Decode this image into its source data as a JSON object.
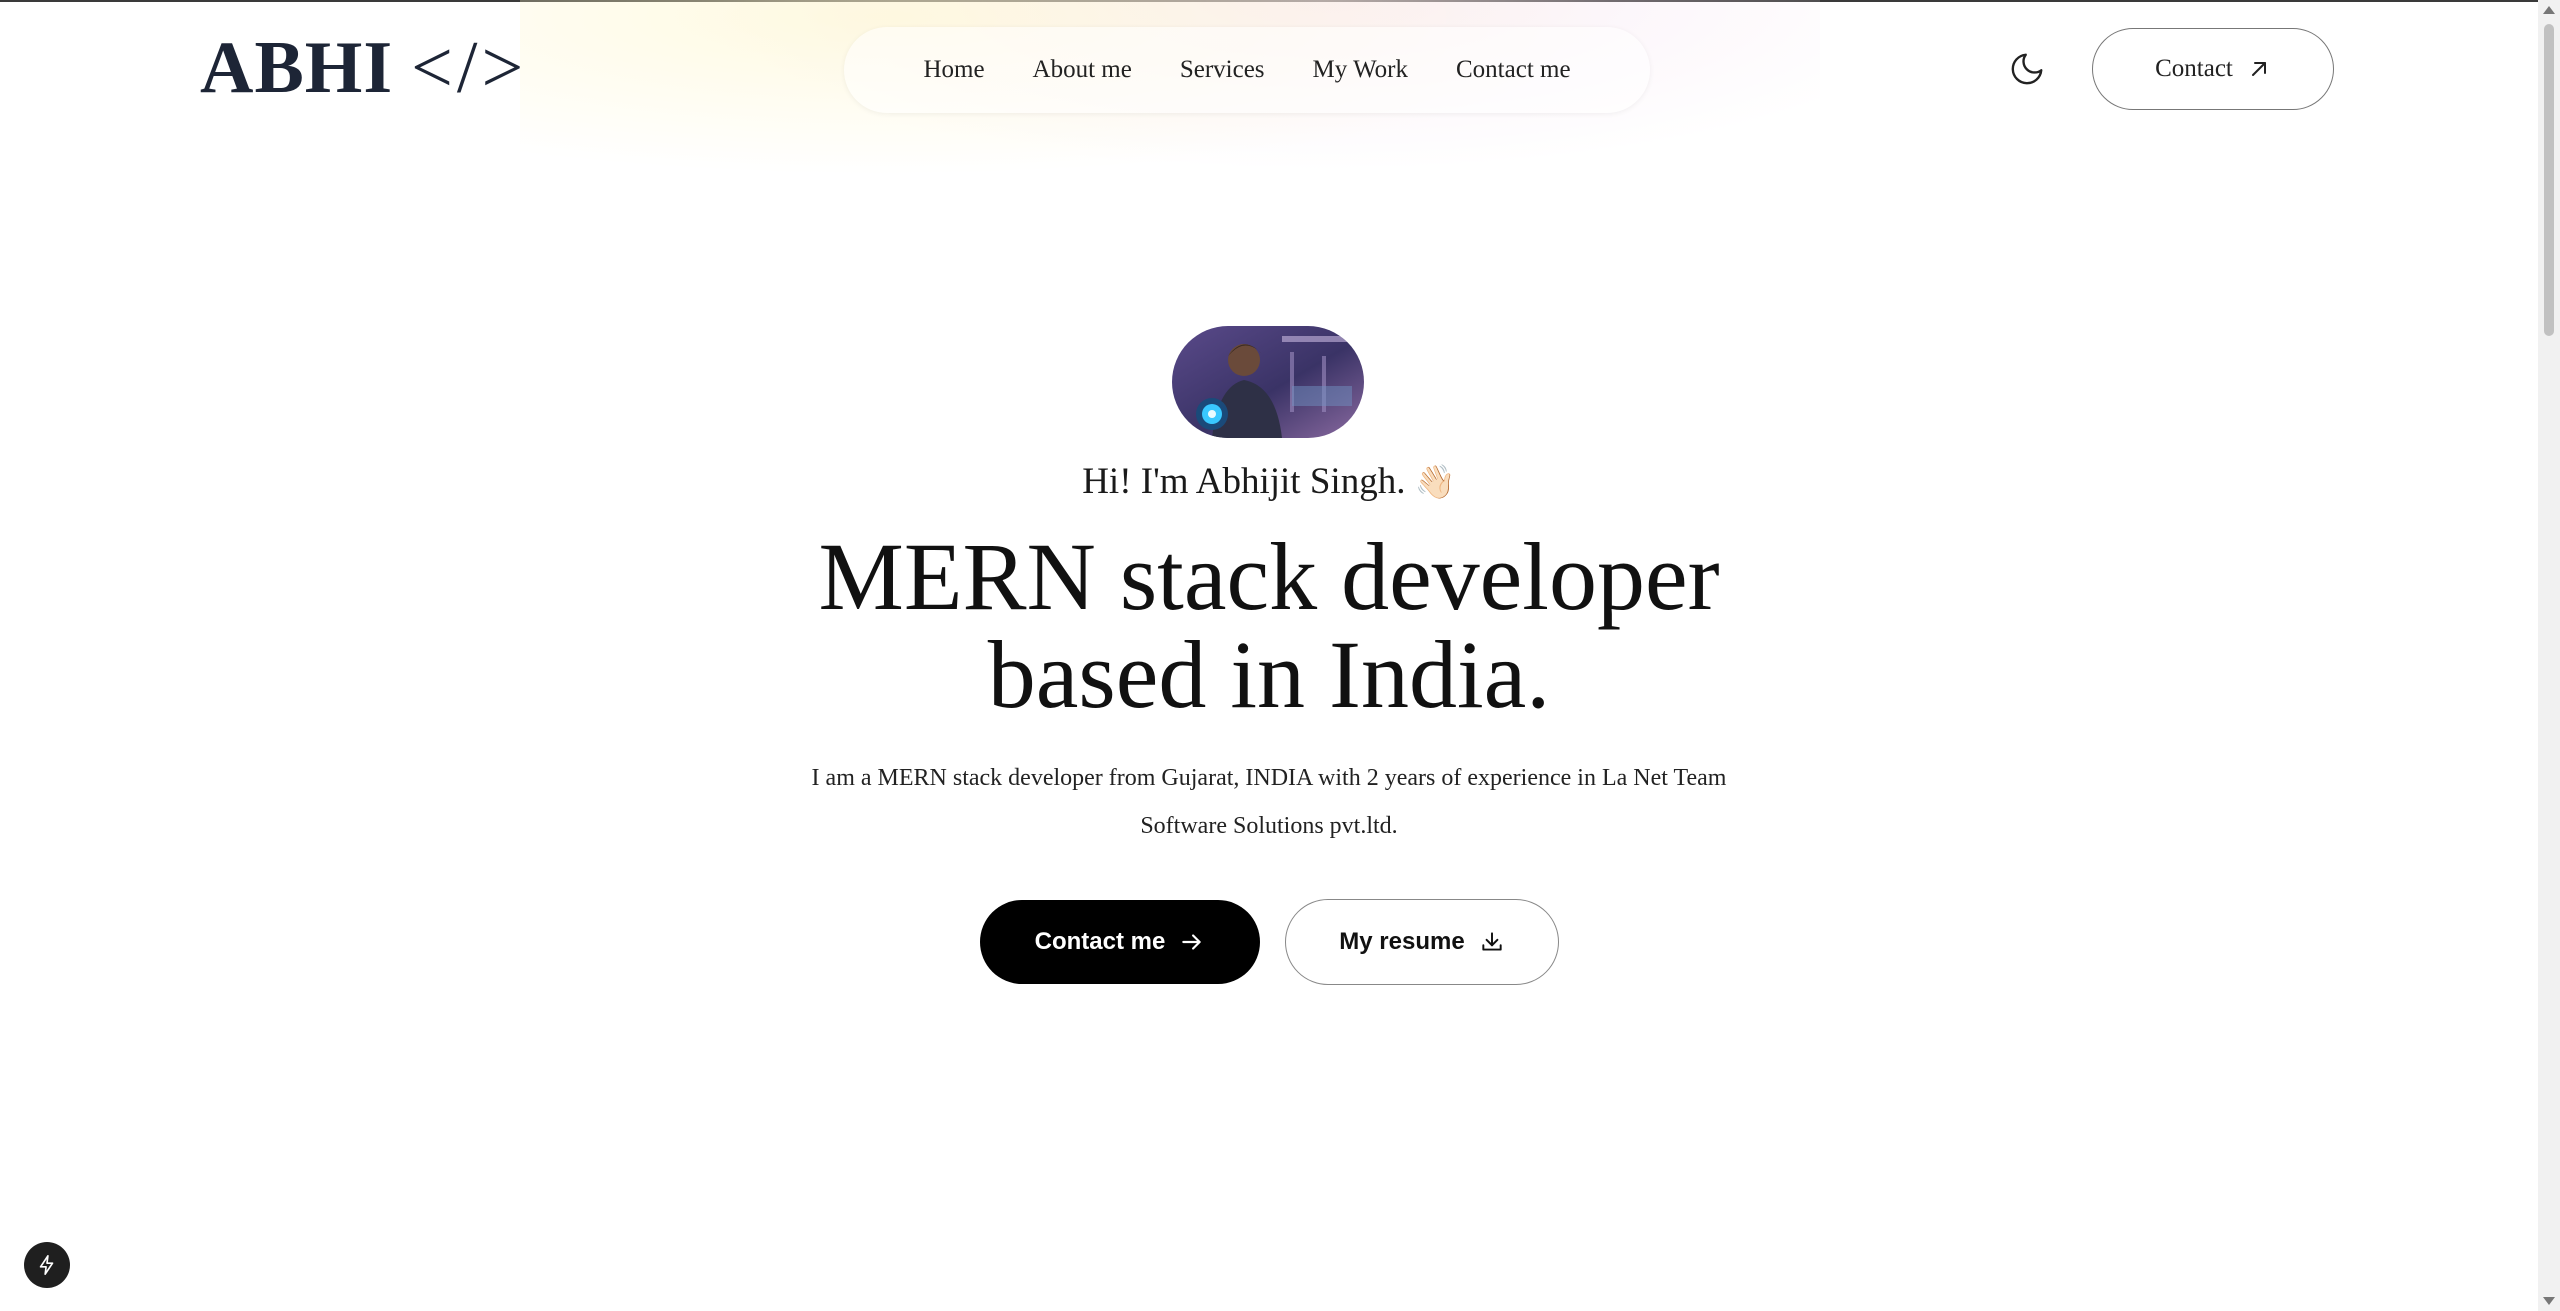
{
  "brand": {
    "name": "ABHI",
    "code_symbol": "</>"
  },
  "nav": {
    "items": [
      {
        "label": "Home"
      },
      {
        "label": "About me"
      },
      {
        "label": "Services"
      },
      {
        "label": "My Work"
      },
      {
        "label": "Contact me"
      }
    ]
  },
  "header": {
    "theme_toggle_icon": "moon-icon",
    "contact_label": "Contact",
    "contact_icon": "arrow-up-right-icon"
  },
  "hero": {
    "greeting": "Hi! I'm Abhijit Singh.",
    "greeting_emoji": "👋🏻",
    "headline_line1": "MERN stack developer",
    "headline_line2": "based in India.",
    "bio_line1": "I am a MERN stack developer from Gujarat, INDIA with 2 years of experience in La Net Team",
    "bio_line2": "Software Solutions pvt.ltd.",
    "contact_button": "Contact me",
    "resume_button": "My resume"
  },
  "colors": {
    "logo": "#1d2536",
    "primary_button_bg": "#000000",
    "primary_button_text": "#ffffff",
    "text": "#111111"
  }
}
